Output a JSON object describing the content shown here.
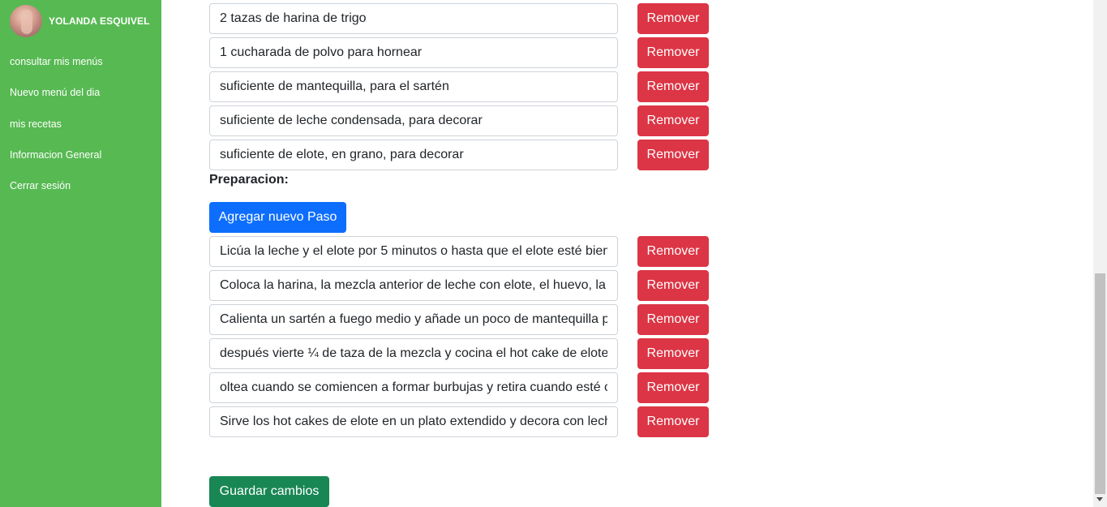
{
  "sidebar": {
    "user_name": "YOLANDA ESQUIVEL",
    "nav": [
      {
        "label": "consultar mis menús"
      },
      {
        "label": "Nuevo menú del dia"
      },
      {
        "label": "mis recetas"
      },
      {
        "label": "Informacion General"
      },
      {
        "label": "Cerrar sesión"
      }
    ],
    "color": "#57b952"
  },
  "ingredients": [
    {
      "value": "2 tazas de harina de trigo",
      "remove_label": "Remover"
    },
    {
      "value": "1 cucharada de polvo para hornear",
      "remove_label": "Remover"
    },
    {
      "value": "suficiente de mantequilla, para el sartén",
      "remove_label": "Remover"
    },
    {
      "value": "suficiente de leche condensada, para decorar",
      "remove_label": "Remover"
    },
    {
      "value": "suficiente de elote, en grano, para decorar",
      "remove_label": "Remover"
    }
  ],
  "preparation": {
    "label": "Preparacion:",
    "add_step_label": "Agregar nuevo Paso",
    "steps": [
      {
        "value": "Licúa la leche y el elote por 5 minutos o hasta que el elote esté bien",
        "remove_label": "Remover"
      },
      {
        "value": "Coloca la harina, la mezcla anterior de leche con elote, el huevo, la m",
        "remove_label": "Remover"
      },
      {
        "value": "Calienta un sartén a fuego medio y añade un poco de mantequilla p",
        "remove_label": "Remover"
      },
      {
        "value": "después vierte ¼ de taza de la mezcla y cocina el hot cake de elote c",
        "remove_label": "Remover"
      },
      {
        "value": "oltea cuando se comiencen a formar burbujas y retira cuando esté c",
        "remove_label": "Remover"
      },
      {
        "value": "Sirve los hot cakes de elote en un plato extendido y decora con lech",
        "remove_label": "Remover"
      }
    ]
  },
  "save_label": "Guardar cambios",
  "colors": {
    "danger": "#dc3545",
    "primary": "#0d6efd",
    "success": "#198754"
  }
}
